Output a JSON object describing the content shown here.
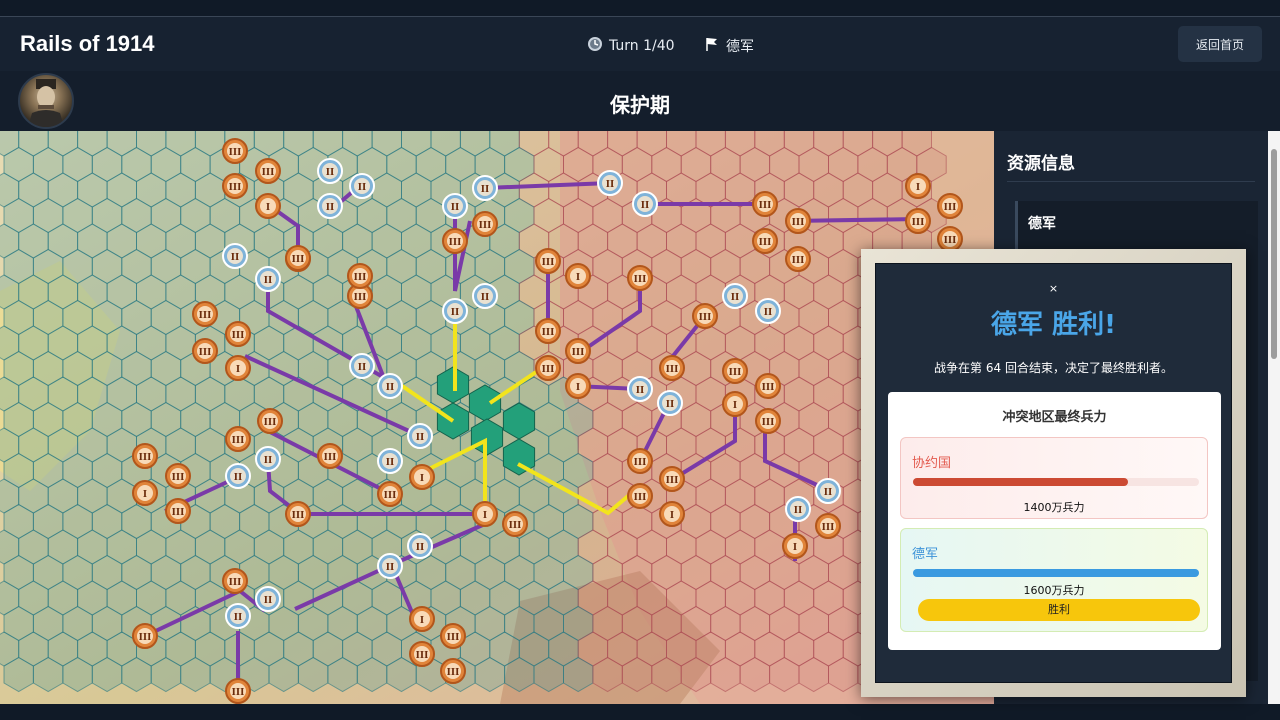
{
  "header": {
    "app_title": "Rails of 1914",
    "turn_icon": "clock-icon",
    "turn_label": "Turn 1/40",
    "faction_icon": "flag-icon",
    "faction_label": "德军",
    "home_button": "返回首页"
  },
  "phase": {
    "title": "保护期",
    "avatar": "commander-portrait"
  },
  "sidebar": {
    "title": "资源信息",
    "faction_name": "德军"
  },
  "modal": {
    "close_label": "×",
    "heading": "德军 胜利!",
    "summary": "战争在第 64 回合结束，决定了最终胜利者。",
    "result_title": "冲突地区最终兵力",
    "entente": {
      "name": "协约国",
      "value_label": "1400万兵力",
      "troops": 1400,
      "color": "#cc4a33"
    },
    "german": {
      "name": "德军",
      "value_label": "1600万兵力",
      "troops": 1600,
      "color": "#3a9ae0"
    },
    "winner_badge": "胜利"
  },
  "map": {
    "unit_colors": {
      "entente": "#e0843a",
      "german": "#7fb3d9",
      "contested": "#23a07a",
      "supply_line": "#7a3aa8",
      "front_line": "#f2e41c"
    },
    "unit_label_entente": "III",
    "unit_label_german": "II",
    "unit_label_small": "I"
  }
}
